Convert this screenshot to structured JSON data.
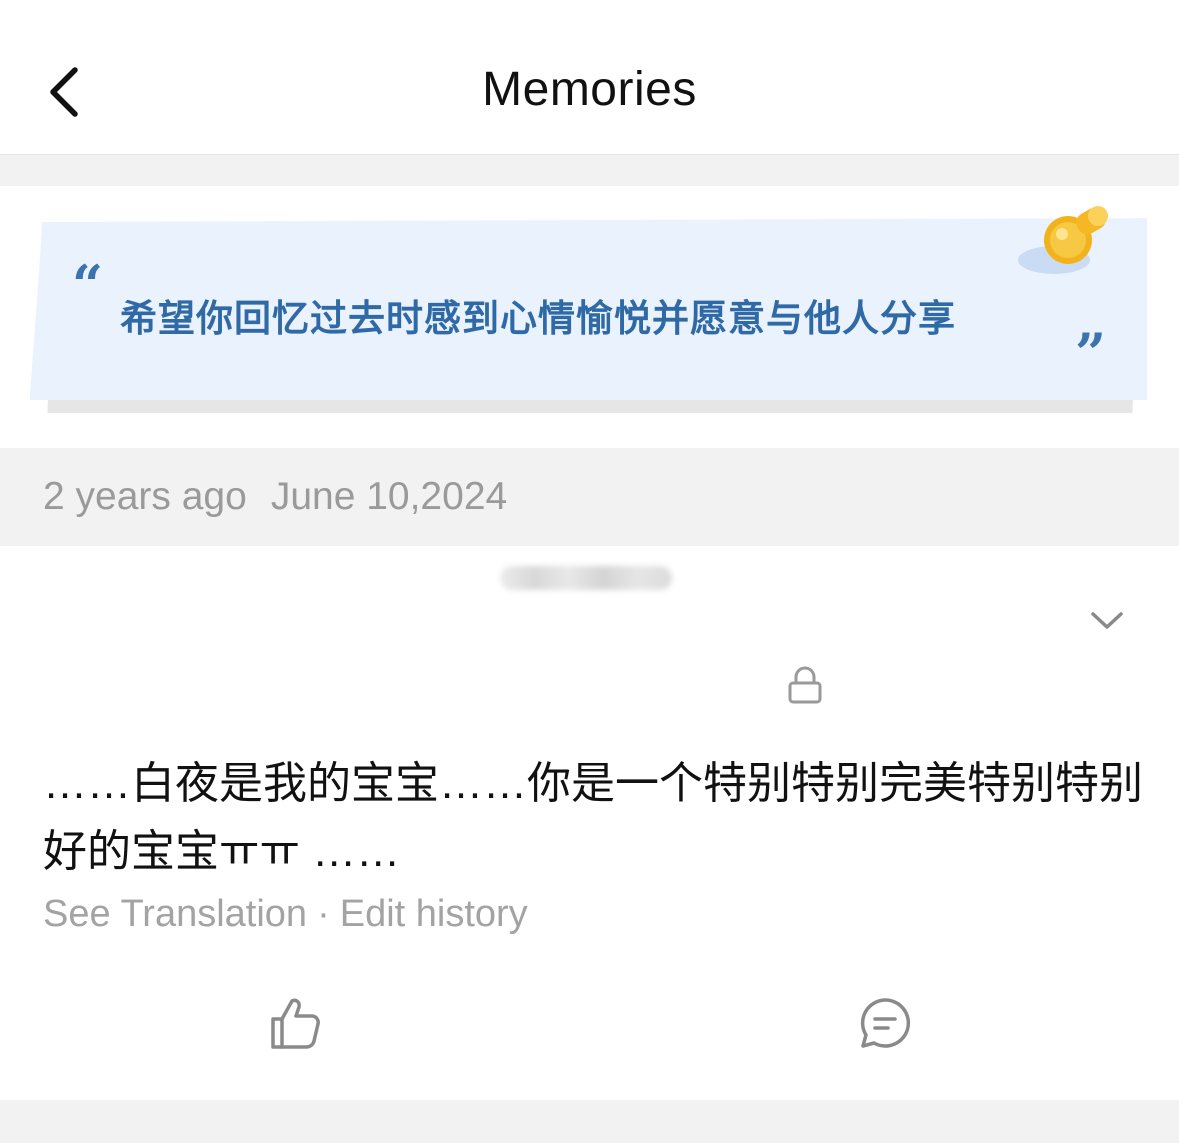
{
  "header": {
    "title": "Memories",
    "back_icon": "chevron-left-icon"
  },
  "banner": {
    "quote_open": "“",
    "quote_close": "”",
    "text": "希望你回忆过去时感到心情愉悦并愿意与他人分享",
    "pin_icon": "pushpin-icon",
    "colors": {
      "text": "#2f6aa6",
      "paper": "#eaf3fd"
    }
  },
  "date": {
    "relative": "2 years ago",
    "absolute": "June 10,2024"
  },
  "post": {
    "author_blurred": true,
    "menu_icon": "chevron-down-icon",
    "visibility_icon": "lock-icon",
    "text": "……白夜是我的宝宝……你是一个特别特别完美特别特别好的宝宝ㅠㅠ ……",
    "see_translation": "See Translation",
    "separator": "·",
    "edit_history": "Edit history",
    "like_icon": "thumbs-up-icon",
    "comment_icon": "comment-icon"
  }
}
